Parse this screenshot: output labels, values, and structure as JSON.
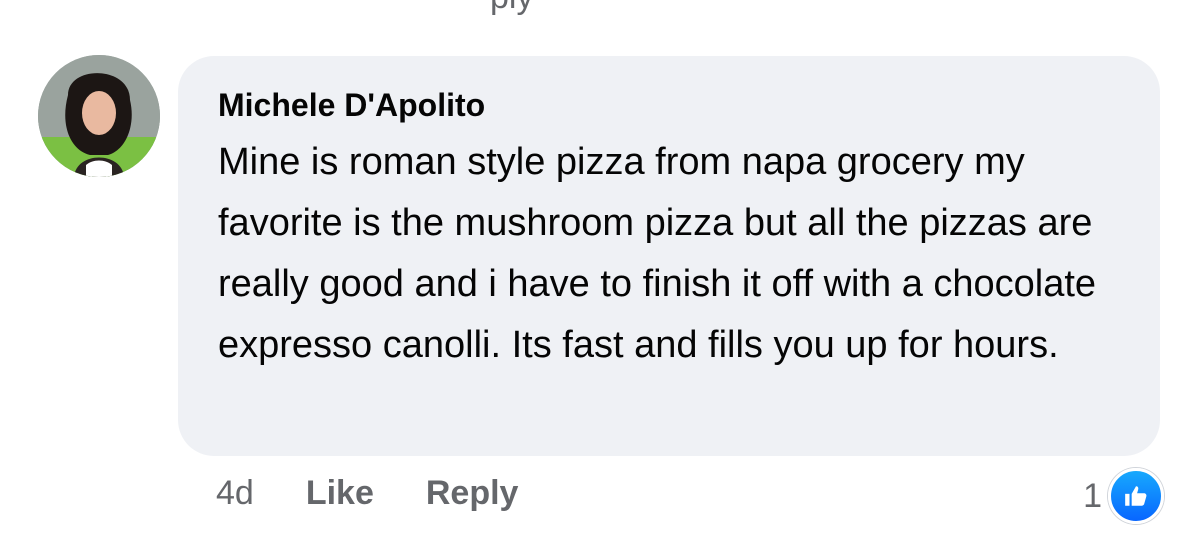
{
  "comment": {
    "author": "Michele D'Apolito",
    "text": "Mine is roman style pizza from napa grocery my favorite is the mushroom pizza but all the pizzas are really good and i have to finish it off with a chocolate expresso canolli. Its fast and fills you up for hours.",
    "timestamp": "4d",
    "like_label": "Like",
    "reply_label": "Reply",
    "reaction_count": "1",
    "reaction_icon": "thumbs-up-icon"
  },
  "colors": {
    "bubble_bg": "#eff1f5",
    "meta_text": "#65676b",
    "like_blue": "#0866ff"
  }
}
